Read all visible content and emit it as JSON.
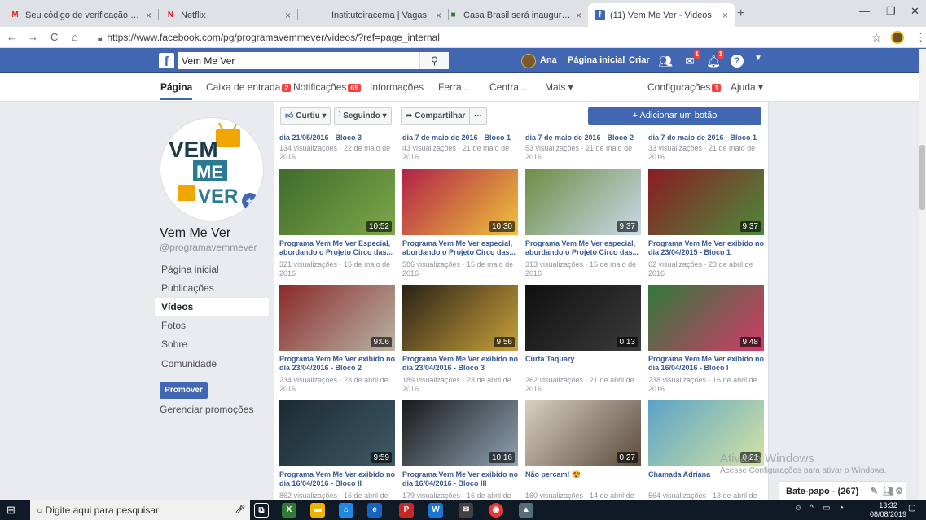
{
  "browser": {
    "tabs": [
      {
        "label": "Seu código de verificação do Yah",
        "icon": "gmail-icon",
        "color": "#d93025"
      },
      {
        "label": "Netflix",
        "icon": "netflix-icon",
        "color": "#e50914"
      },
      {
        "label": "Institutoiracema | Vagas",
        "icon": "",
        "color": "#888"
      },
      {
        "label": "Casa Brasil será inaugurada - Inst",
        "icon": "site-icon",
        "color": "#2e7d32"
      },
      {
        "label": "(11) Vem Me Ver - Videos",
        "icon": "facebook-icon",
        "color": "#4267b2"
      }
    ],
    "url": "https://www.facebook.com/pg/programavemmever/videos/?ref=page_internal"
  },
  "fb_header": {
    "search_value": "Vem Me Ver",
    "user": "Ana",
    "home": "Página inicial",
    "create": "Criar",
    "badges": {
      "messages": "1",
      "notifications": "1"
    }
  },
  "page_tabs": [
    {
      "label": "Página"
    },
    {
      "label": "Caixa de entrada",
      "count": "2"
    },
    {
      "label": "Notificações",
      "count": "69"
    },
    {
      "label": "Informações"
    },
    {
      "label": "Ferra..."
    },
    {
      "label": "Centra..."
    },
    {
      "label": "Mais ▾"
    },
    {
      "label": "Configurações",
      "count": "1"
    },
    {
      "label": "Ajuda ▾"
    }
  ],
  "sidebar": {
    "name": "Vem Me Ver",
    "handle": "@programavemmever",
    "logo_words": [
      "VEM",
      "ME",
      "VER"
    ],
    "items": [
      "Página inicial",
      "Publicações",
      "Vídeos",
      "Fotos",
      "Sobre",
      "Comunidade"
    ],
    "promote": "Promover",
    "manage": "Gerenciar promoções"
  },
  "actions": {
    "like": "Curtiu ▾",
    "follow": "Seguindo ▾",
    "share": "Compartilhar",
    "more": "···",
    "add_button": "+ Adicionar um botão"
  },
  "top_row": [
    {
      "title": "dia 21/05/2016 - Bloco 3",
      "meta": "134 visualizações · 22 de maio de 2016"
    },
    {
      "title": "dia 7 de maio de 2016 - Bloco 1",
      "meta": "43 visualizações · 21 de maio de 2016"
    },
    {
      "title": "dia 7 de maio de 2016 - Bloco 2",
      "meta": "53 visualizações · 21 de maio de 2016"
    },
    {
      "title": "dia 7 de maio de 2016 - Bloco 1",
      "meta": "33 visualizações · 21 de maio de 2016"
    }
  ],
  "videos": [
    {
      "duration": "10:52",
      "title": "Programa Vem Me Ver Especial, abordando o Projeto Circo das...",
      "meta": "321 visualizações · 16 de maio de 2016",
      "c1": "#3f6b2a",
      "c2": "#7ea84b"
    },
    {
      "duration": "10:30",
      "title": "Programa Vem Me Ver especial, abordando o Projeto Circo das...",
      "meta": "586 visualizações · 15 de maio de 2016",
      "c1": "#b0224a",
      "c2": "#f0c33a"
    },
    {
      "duration": "9:37",
      "title": "Programa Vem Me Ver especial, abordando o Projeto Circo das...",
      "meta": "313 visualizações · 15 de maio de 2016",
      "c1": "#6d8d46",
      "c2": "#c9d9e8"
    },
    {
      "duration": "9:37",
      "title": "Programa Vem Me Ver exibido no dia 23/04/2015 - Bloco 1",
      "meta": "62 visualizações · 23 de abril de 2016",
      "c1": "#8a1c24",
      "c2": "#4e8a3a"
    },
    {
      "duration": "9:06",
      "title": "Programa Vem Me Ver exibido no dia 23/04/2016 - Bloco 2",
      "meta": "234 visualizações · 23 de abril de 2016",
      "c1": "#8b2a2a",
      "c2": "#b8b4a4"
    },
    {
      "duration": "9:56",
      "title": "Programa Vem Me Ver exibido no dia 23/04/2016 - Bloco 3",
      "meta": "189 visualizações · 23 de abril de 2016",
      "c1": "#2a2218",
      "c2": "#c9a13a"
    },
    {
      "duration": "0:13",
      "title": "Curta Taquary",
      "meta": "262 visualizações · 21 de abril de 2016",
      "c1": "#101010",
      "c2": "#3b3b3b"
    },
    {
      "duration": "9:48",
      "title": "Programa Vem Me Ver exibido no dia 16/04/2016 - Bloco I",
      "meta": "238 visualizações · 16 de abril de 2016",
      "c1": "#2f7a3a",
      "c2": "#d23a6a"
    },
    {
      "duration": "9:59",
      "title": "Programa Vem Me Ver exibido no dia 16/04/2016 - Bloco II",
      "meta": "862 visualizações · 16 de abril de",
      "c1": "#1b2a33",
      "c2": "#3e5a66"
    },
    {
      "duration": "10:16",
      "title": "Programa Vem Me Ver exibido no dia 16/04/2016 - Bloco III",
      "meta": "179 visualizações · 16 de abril de",
      "c1": "#1a1a1a",
      "c2": "#8fa2b5"
    },
    {
      "duration": "0:27",
      "title": "Não percam! 😍",
      "meta": "160 visualizações · 14 de abril de 2016",
      "c1": "#d8cfc2",
      "c2": "#5a4a3a"
    },
    {
      "duration": "0:21",
      "title": "Chamada Adriana",
      "meta": "564 visualizações · 13 de abril de 2016",
      "c1": "#5ba2c8",
      "c2": "#d4e4a2"
    }
  ],
  "chat": "Bate-papo - (267)",
  "watermark": {
    "title": "Ativar o Windows",
    "sub": "Acesse Configurações para ativar o Windows."
  },
  "taskbar": {
    "search": "Digite aqui para pesquisar",
    "time": "13:32",
    "date": "08/08/2019"
  }
}
